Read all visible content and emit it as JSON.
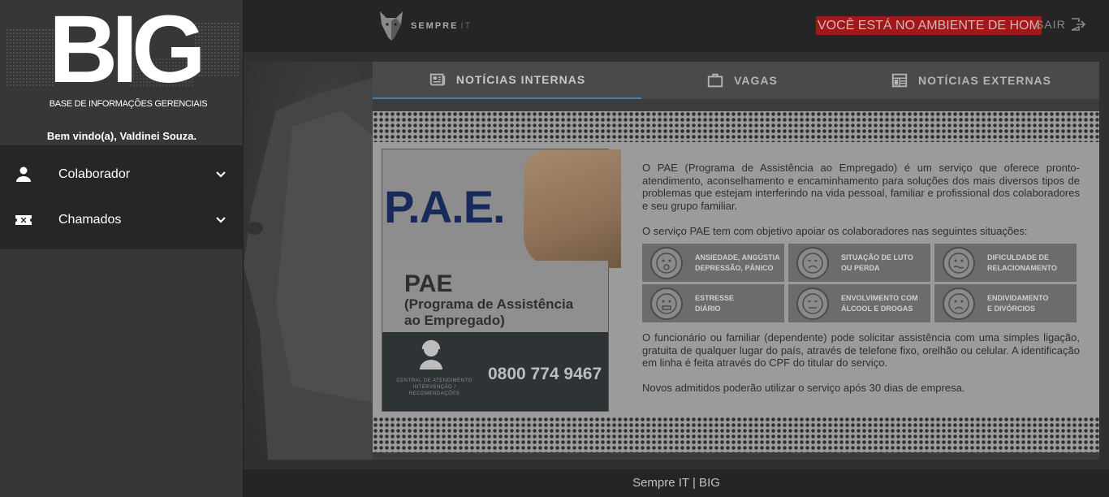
{
  "header": {
    "brand_name": "SEMPRE",
    "brand_suffix": "IT",
    "env_banner": "VOCÊ ESTÁ NO AMBIENTE DE HOM",
    "logout_label": "SAIR",
    "logout_icon": "logout-icon"
  },
  "sidebar": {
    "logo_text": "BIG",
    "logo_subtitle": "BASE DE INFORMAÇÕES GERENCIAIS",
    "welcome": "Bem vindo(a), Valdinei Souza.",
    "items": [
      {
        "label": "Colaborador",
        "icon": "person-icon"
      },
      {
        "label": "Chamados",
        "icon": "ticket-icon"
      }
    ]
  },
  "tabs": [
    {
      "label": "NOTÍCIAS INTERNAS",
      "icon": "newspaper-icon",
      "active": true
    },
    {
      "label": "VAGAS",
      "icon": "briefcase-icon",
      "active": false
    },
    {
      "label": "NOTÍCIAS EXTERNAS",
      "icon": "news-layout-icon",
      "active": false
    }
  ],
  "news": {
    "poster": {
      "title": "P.A.E.",
      "name": "PAE",
      "full_name_line1": "(Programa de Assistência",
      "full_name_line2": "ao Empregado)",
      "phone": "0800 774 9467",
      "central_line1": "CENTRAL DE ATENDIMENTO",
      "central_line2": "INTERVENÇÃO /",
      "central_line3": "RECOMENDAÇÕES"
    },
    "paragraph1": "O PAE (Programa de Assistência ao Empregado) é um serviço que oferece pronto-atendimento, aconselhamento e encaminhamento para soluções dos mais diversos tipos de problemas que estejam interferindo na vida pessoal, familiar e profissional dos colaboradores e seu grupo familiar.",
    "paragraph2": "O serviço PAE tem com objetivo apoiar os colaboradores nas seguintes situações:",
    "situations": [
      {
        "line1": "ANSIEDADE, ANGÚSTIA",
        "line2": "DEPRESSÃO, PÂNICO"
      },
      {
        "line1": "SITUAÇÃO DE LUTO",
        "line2": "OU PERDA"
      },
      {
        "line1": "DIFICULDADE DE",
        "line2": "RELACIONAMENTO"
      },
      {
        "line1": "ESTRESSE",
        "line2": "DIÁRIO"
      },
      {
        "line1": "ENVOLVIMENTO COM",
        "line2": "ÁLCOOL E DROGAS"
      },
      {
        "line1": "ENDIVIDAMENTO",
        "line2": "E DIVÓRCIOS"
      }
    ],
    "paragraph3": "O funcionário ou familiar (dependente) pode solicitar assistência com uma simples ligação, gratuita de qualquer lugar do país, através de telefone fixo, orelhão ou celular. A identificação em linha é feita através do CPF do titular do serviço.",
    "paragraph4": "Novos admitidos poderão utilizar o serviço após 30 dias de empresa."
  },
  "footer": {
    "text": "Sempre IT | BIG"
  }
}
